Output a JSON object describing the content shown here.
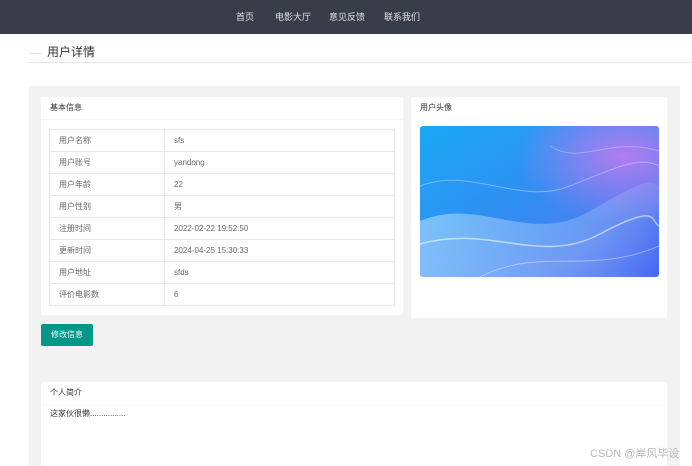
{
  "nav": {
    "items": [
      {
        "label": "首页"
      },
      {
        "label": "电影大厅"
      },
      {
        "label": "意见反馈"
      },
      {
        "label": "联系我们"
      }
    ]
  },
  "page": {
    "title": "用户详情"
  },
  "basic_info": {
    "header": "基本信息",
    "rows": [
      {
        "key": "用户名称",
        "value": "sfs"
      },
      {
        "key": "用户账号",
        "value": "yandong"
      },
      {
        "key": "用户年龄",
        "value": "22"
      },
      {
        "key": "用户性别",
        "value": "男"
      },
      {
        "key": "注册时间",
        "value": "2022-02-22 19:52:50"
      },
      {
        "key": "更新时间",
        "value": "2024-04-25 15:30:33"
      },
      {
        "key": "用户地址",
        "value": "sfds"
      },
      {
        "key": "评价电影数",
        "value": "6"
      }
    ]
  },
  "avatar": {
    "header": "用户头像"
  },
  "actions": {
    "edit_label": "修改信息"
  },
  "bio": {
    "header": "个人简介",
    "text": "这家伙很懒................"
  },
  "watermark": "CSDN @岸风毕设",
  "colors": {
    "nav_bg": "#393d49",
    "primary_button": "#009688",
    "content_bg": "#f2f2f2"
  }
}
